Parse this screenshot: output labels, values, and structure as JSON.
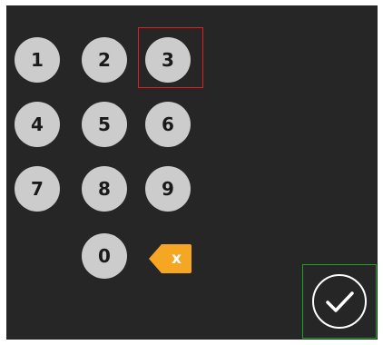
{
  "keypad": {
    "keys": [
      "1",
      "2",
      "3",
      "4",
      "5",
      "6",
      "7",
      "8",
      "9",
      "0"
    ]
  },
  "backspace": {
    "label": "x",
    "icon": "backspace-icon",
    "color": "#f5a623"
  },
  "confirm": {
    "icon": "checkmark-icon"
  },
  "highlight": {
    "selected_key": "3",
    "selected_color": "#e0201f",
    "confirm_color": "#1ea31e"
  }
}
